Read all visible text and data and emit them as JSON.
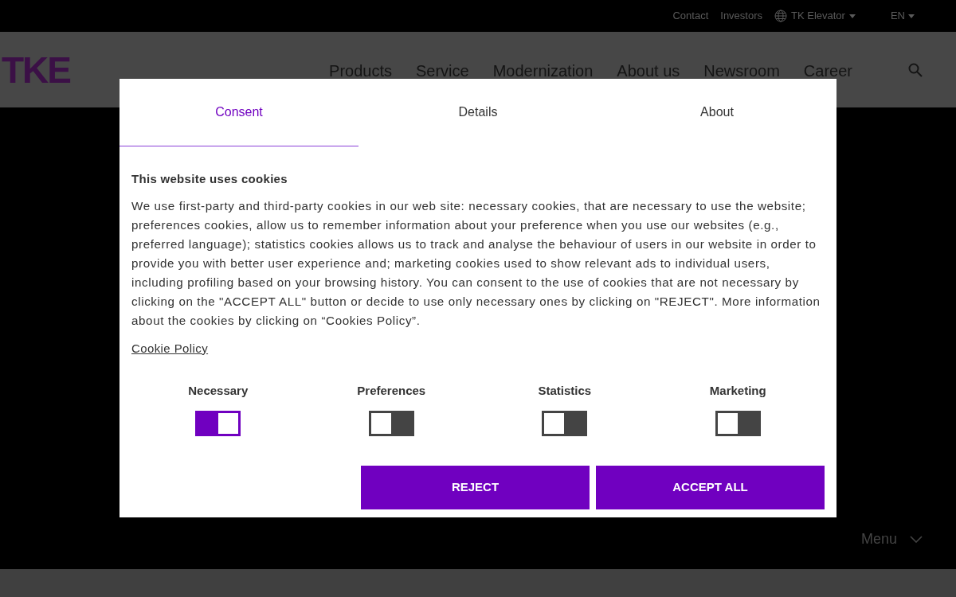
{
  "top_bar": {
    "links": [
      "Contact",
      "Investors"
    ],
    "site_selector": "TK Elevator",
    "language": "EN"
  },
  "header": {
    "logo": "TKE",
    "nav": [
      "Products",
      "Service",
      "Modernization",
      "About us",
      "Newsroom",
      "Career"
    ]
  },
  "dialog": {
    "tabs": [
      {
        "label": "Consent",
        "selected": true
      },
      {
        "label": "Details",
        "selected": false
      },
      {
        "label": "About",
        "selected": false
      }
    ],
    "title": "This website uses cookies",
    "body": "We use first-party and third-party cookies in our web site: necessary cookies, that are necessary to use the website; preferences cookies, allow us to remember information about your preference when you use our websites (e.g., preferred language); statistics cookies allows us to track and analyse the behaviour of users in our website in order to provide you with better user experience and; marketing cookies used to show relevant ads to individual users, including profiling based on your browsing history. You can consent to the use of cookies that are not necessary by clicking on the \"ACCEPT ALL\" button or decide to use only necessary ones by clicking on \"REJECT\". More information about the cookies by clicking on “Cookies Policy”.",
    "policy_link": "Cookie Policy",
    "toggles": [
      {
        "label": "Necessary",
        "on": true
      },
      {
        "label": "Preferences",
        "on": false
      },
      {
        "label": "Statistics",
        "on": false
      },
      {
        "label": "Marketing",
        "on": false
      }
    ],
    "buttons": [
      "REJECT",
      "ACCEPT ALL"
    ]
  },
  "menu_button": "Menu"
}
